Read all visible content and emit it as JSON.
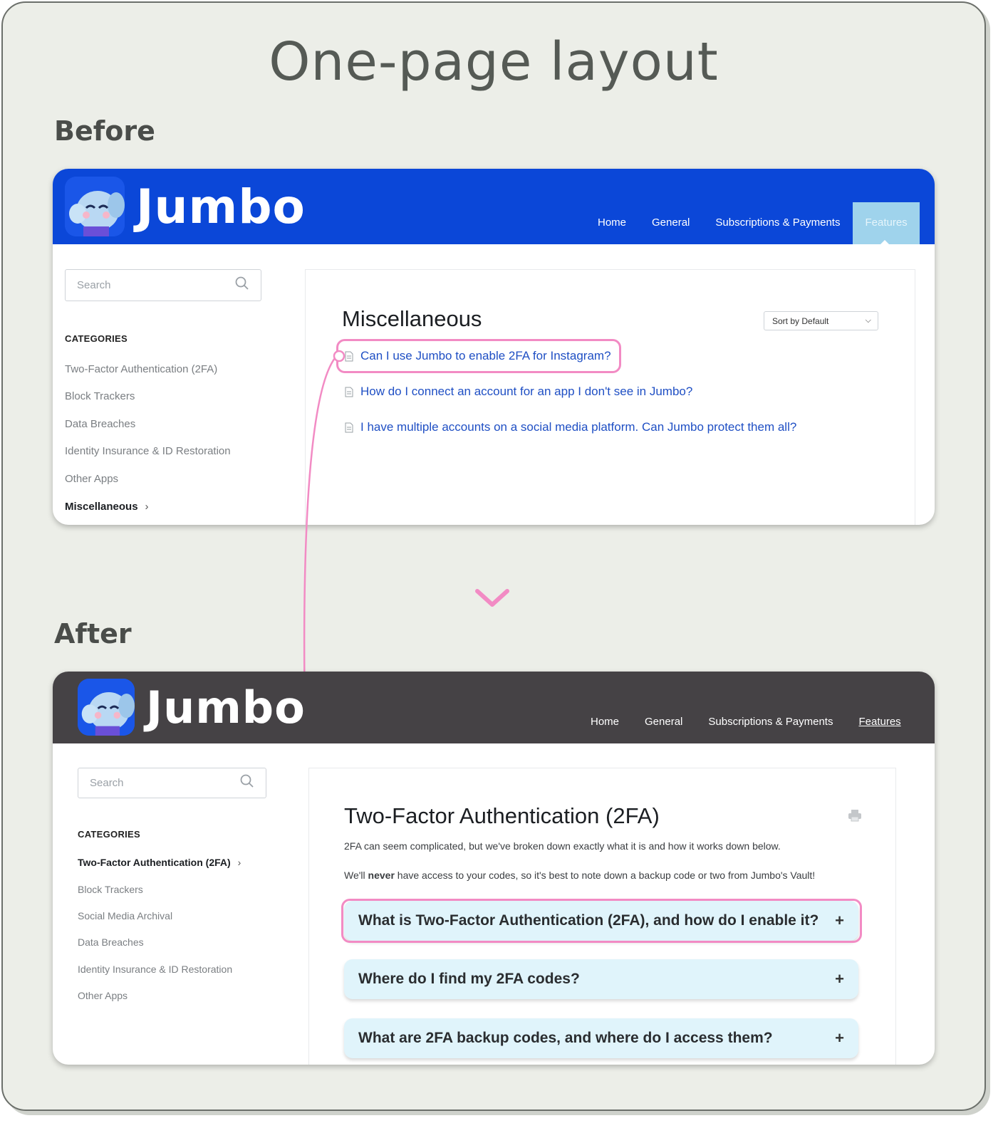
{
  "title": "One-page layout",
  "before": {
    "label": "Before",
    "brand": "Jumbo",
    "nav": [
      "Home",
      "General",
      "Subscriptions & Payments",
      "Features"
    ],
    "search_placeholder": "Search",
    "categories_heading": "CATEGORIES",
    "categories": [
      "Two-Factor Authentication (2FA)",
      "Block Trackers",
      "Data Breaches",
      "Identity Insurance & ID Restoration",
      "Other Apps",
      "Miscellaneous"
    ],
    "heading": "Miscellaneous",
    "sort_label": "Sort by Default",
    "articles": [
      "Can I use Jumbo to enable 2FA for Instagram?",
      "How do I connect an account for an app I don't see in Jumbo?",
      "I have multiple accounts on a social media platform. Can Jumbo protect them all?"
    ],
    "header_color": "#0b47d8",
    "active_tab_color": "#9fd3ec"
  },
  "after": {
    "label": "After",
    "brand": "Jumbo",
    "nav": [
      "Home",
      "General",
      "Subscriptions & Payments",
      "Features"
    ],
    "search_placeholder": "Search",
    "categories_heading": "CATEGORIES",
    "categories": [
      "Two-Factor Authentication (2FA)",
      "Block Trackers",
      "Social Media Archival",
      "Data Breaches",
      "Identity Insurance & ID Restoration",
      "Other Apps"
    ],
    "heading": "Two-Factor Authentication (2FA)",
    "intro": "2FA can seem complicated, but we've broken down exactly what it is and how it works down below.",
    "note_pre": "We'll ",
    "note_bold": "never",
    "note_post": " have access to your codes, so it's best to note down a backup code or two from Jumbo's Vault!",
    "accordions": [
      "What is Two-Factor Authentication (2FA), and how do I enable it?",
      "Where do I find my 2FA codes?",
      "What are 2FA backup codes, and where do I access them?"
    ],
    "header_color": "#454245"
  },
  "colors": {
    "highlight": "#f28bc4",
    "link": "#1f4fc4",
    "accordion_bg": "#e0f4fb"
  }
}
